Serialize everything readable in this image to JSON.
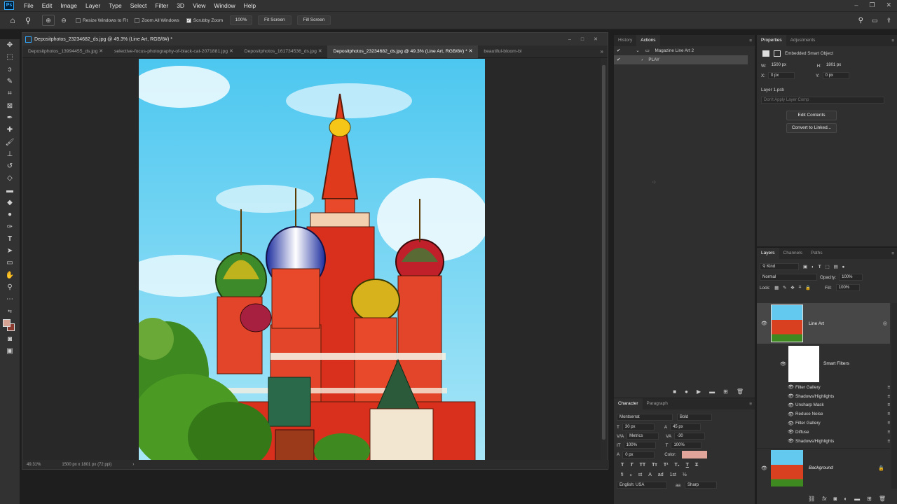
{
  "app": {
    "logo": "Ps"
  },
  "menu": [
    "File",
    "Edit",
    "Image",
    "Layer",
    "Type",
    "Select",
    "Filter",
    "3D",
    "View",
    "Window",
    "Help"
  ],
  "options": {
    "resize_windows": "Resize Windows to Fit",
    "zoom_all": "Zoom All Windows",
    "scrubby": "Scrubby Zoom",
    "zoom_value": "100%",
    "fit_screen": "Fit Screen",
    "fill_screen": "Fill Screen"
  },
  "document": {
    "title": "Depositphotos_23234682_ds.jpg @ 49.3% (Line Art, RGB/8#) *",
    "tabs": [
      {
        "label": "Depositphotos_13994455_ds.jpg"
      },
      {
        "label": "selective-focus-photography-of-black-cat-2071881.jpg"
      },
      {
        "label": "Depositphotos_161734536_ds.jpg"
      },
      {
        "label": "Depositphotos_23234682_ds.jpg @ 49.3% (Line Art, RGB/8#) *"
      },
      {
        "label": "beautiful-bloom-bl"
      }
    ],
    "zoom": "49.31%",
    "size": "1500 px x 1801 px (72 ppi)"
  },
  "history_panel": {
    "tabs": [
      "History",
      "Actions"
    ],
    "set_name": "Magazine Line Art 2",
    "action_name": "PLAY"
  },
  "properties_panel": {
    "tabs": [
      "Properties",
      "Adjustments"
    ],
    "type": "Embedded Smart Object",
    "w_label": "W:",
    "w": "1500 px",
    "h_label": "H:",
    "h": "1801 px",
    "x_label": "X:",
    "x": "0 px",
    "y_label": "Y:",
    "y": "0 px",
    "file": "Layer 1.psb",
    "layer_comp": "Don't Apply Layer Comp",
    "edit_contents": "Edit Contents",
    "convert": "Convert to Linked..."
  },
  "layers_panel": {
    "tabs": [
      "Layers",
      "Channels",
      "Paths"
    ],
    "kind": "Kind",
    "blend": "Normal",
    "opacity_label": "Opacity:",
    "opacity": "100%",
    "lock_label": "Lock:",
    "fill_label": "Fill:",
    "fill": "100%",
    "layers": {
      "line_art": "Line Art",
      "smart_filters": "Smart Filters",
      "background": "Background"
    },
    "filters": [
      "Filter Gallery",
      "Shadows/Highlights",
      "Unsharp Mask",
      "Reduce Noise",
      "Filter Gallery",
      "Diffuse",
      "Shadows/Highlights"
    ]
  },
  "character_panel": {
    "tabs": [
      "Character",
      "Paragraph"
    ],
    "font": "Montserrat",
    "style": "Bold",
    "size": "30 px",
    "leading": "45 px",
    "kerning": "Metrics",
    "tracking": "-30",
    "vscale": "100%",
    "hscale": "100%",
    "baseline": "0 px",
    "color_label": "Color:",
    "color": "#e0a49a",
    "language": "English: USA",
    "antialias": "Sharp"
  },
  "colors": {
    "fg": "#d9a394",
    "bg": "#8a3a2e",
    "accent": "#31a8ff"
  }
}
